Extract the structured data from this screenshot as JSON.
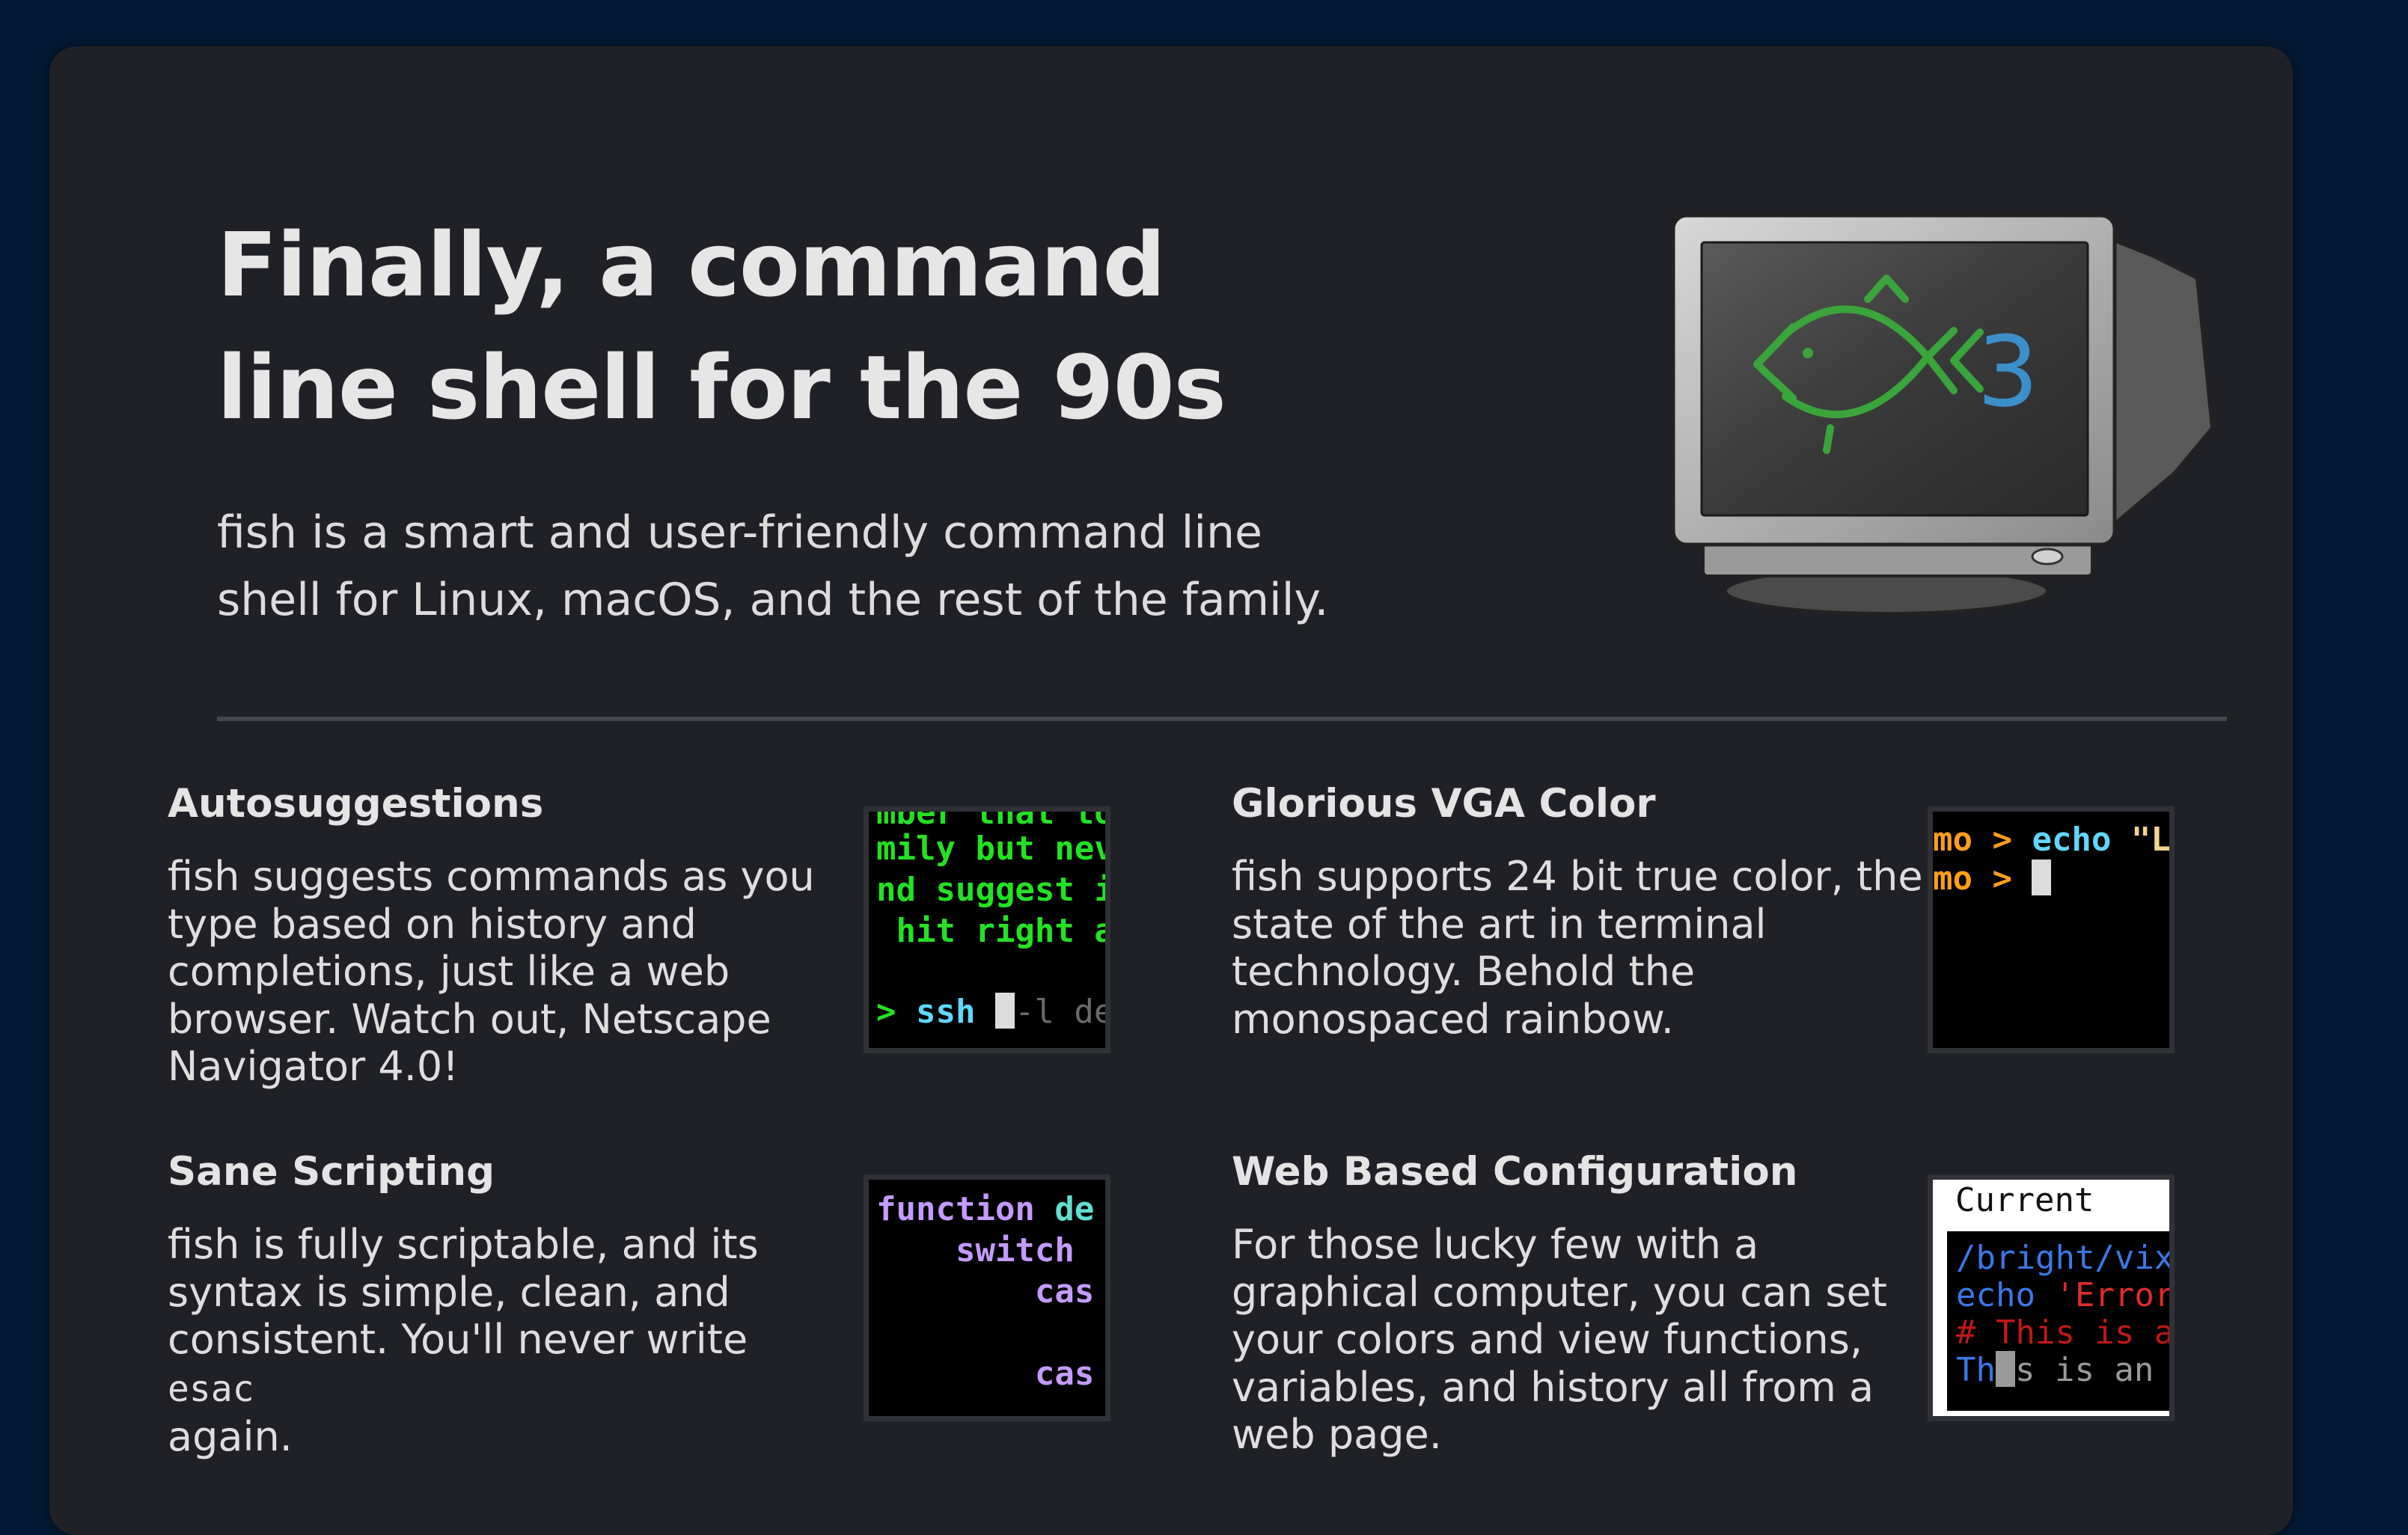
{
  "hero": {
    "title_line1": "Finally, a command",
    "title_line2": "line shell for the 90s",
    "subtitle_line1": "fish is a smart and user-friendly command line",
    "subtitle_line2": "shell for Linux, macOS, and the rest of the family.",
    "logo_text": "<3"
  },
  "features": {
    "autosuggestions": {
      "title": "Autosuggestions",
      "body_lines": [
        "fish suggests commands as you",
        "type based on history and",
        "completions, just like a web",
        "browser. Watch out, Netscape",
        "Navigator 4.0!"
      ],
      "terminal": {
        "l1": "mber that to",
        "l2": "mily but neve",
        "l3": "nd suggest it",
        "l4": " hit right a",
        "prompt": "> ",
        "cmd": "ssh ",
        "suggestion": "-l den"
      }
    },
    "vga": {
      "title": "Glorious VGA Color",
      "body_lines": [
        "fish supports 24 bit true color, the",
        "state of the art in terminal",
        "technology. Behold the",
        "monospaced rainbow."
      ],
      "terminal": {
        "l1_prompt": "mo > ",
        "l1_cmd": "echo ",
        "l1_str": "\"Lo",
        "l2_prompt": "mo > "
      }
    },
    "scripting": {
      "title": "Sane Scripting",
      "body_lines": [
        "fish is fully scriptable, and its",
        "syntax is simple, clean, and"
      ],
      "body_line3_pre": "consistent. You'll never write ",
      "body_line3_code": "esac",
      "body_line4": "again.",
      "terminal": {
        "l1_kw": "function ",
        "l1_name": "de",
        "l2": "    switch",
        "l3": "        cas",
        "l4": "        cas"
      }
    },
    "webconfig": {
      "title": "Web Based Configuration",
      "body_lines": [
        "For those lucky few with a",
        "graphical computer, you can set",
        "your colors and view functions,",
        "variables, and history all from a",
        "web page."
      ],
      "thumb": {
        "header": "Current",
        "l1": "/bright/vixe",
        "l2_cmd": "echo ",
        "l2_str": "'Errors",
        "l3": "# This is a",
        "l4_a": "Th",
        "l4_b": "s is an a"
      }
    }
  },
  "colors": {
    "page_bg": "#031a35",
    "panel_bg": "#202127",
    "fish_green": "#3aa53a",
    "logo_blue": "#3b8fcb",
    "term_green": "#22e322",
    "term_cyan": "#5fd7ff",
    "term_orange": "#ff9f1a",
    "term_purple": "#c49bff",
    "term_teal": "#5fe0d0"
  }
}
